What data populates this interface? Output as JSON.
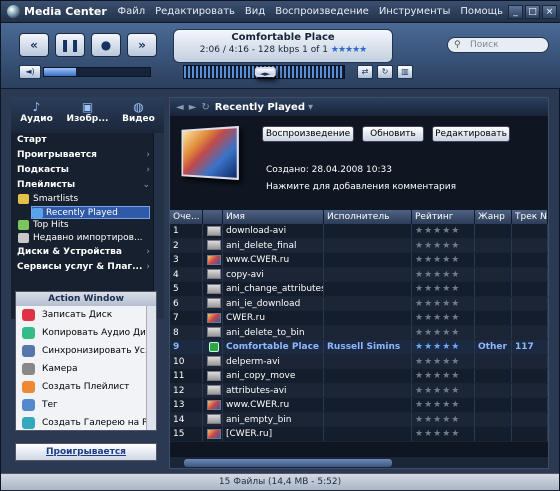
{
  "app": {
    "title": "Media Center"
  },
  "menu": [
    "Файл",
    "Редактировать",
    "Вид",
    "Воспроизведение",
    "Инструменты",
    "Помощь"
  ],
  "now_playing": {
    "title": "Comfortable Place",
    "info": "2:06 / 4:16 - 128 kbps  1 of 1",
    "rating_stars": "★★★★★"
  },
  "search": {
    "placeholder": "Поиск"
  },
  "sidebar": {
    "tabs": [
      {
        "label": "Аудио",
        "icon": "note-icon"
      },
      {
        "label": "Изобр...",
        "icon": "image-icon"
      },
      {
        "label": "Видео",
        "icon": "globe-icon"
      }
    ],
    "nav": [
      "Старт",
      "Проигрывается",
      "Подкасты",
      "Плейлисты"
    ],
    "playlists": [
      {
        "label": "Smartlists",
        "icon": "folder-icon",
        "color": "#e4c24a"
      },
      {
        "label": "Recently Played",
        "icon": "playlist-icon",
        "color": "#59a4e8"
      },
      {
        "label": "Top Hits",
        "icon": "playlist-icon",
        "color": "#7ac65a"
      },
      {
        "label": "Недавно импортиров...",
        "icon": "playlist-icon",
        "color": "#c8c8c8"
      }
    ],
    "nav2": [
      "Диски & Устройства",
      "Сервисы услуг & Плаг..."
    ],
    "action_window": {
      "title": "Action Window",
      "items": [
        {
          "label": "Записать Диск",
          "color": "#d34"
        },
        {
          "label": "Копировать Аудио Ди...",
          "color": "#3b8"
        },
        {
          "label": "Синхронизировать Ус...",
          "color": "#57a"
        },
        {
          "label": "Камера",
          "color": "#888"
        },
        {
          "label": "Создать Плейлист",
          "color": "#e83"
        },
        {
          "label": "Тег",
          "color": "#58c"
        },
        {
          "label": "Создать Галерею на Р...",
          "color": "#3ab"
        }
      ]
    },
    "now_playing_link": "Проигрывается"
  },
  "main": {
    "title": "Recently Played",
    "buttons": [
      "Воспроизведение",
      "Обновить",
      "Редактировать"
    ],
    "created": "Создано: 28.04.2008 10:33",
    "note": "Нажмите для добавления комментария",
    "columns": [
      "Оче...",
      "",
      "Имя",
      "Исполнитель",
      "Рейтинг",
      "Жанр",
      "Трек №"
    ],
    "rows": [
      {
        "n": "1",
        "icon": "file",
        "name": "download-avi",
        "artist": "",
        "genre": "",
        "track": ""
      },
      {
        "n": "2",
        "icon": "file",
        "name": "ani_delete_final",
        "artist": "",
        "genre": "",
        "track": ""
      },
      {
        "n": "3",
        "icon": "img",
        "name": "www.CWER.ru",
        "artist": "",
        "genre": "",
        "track": ""
      },
      {
        "n": "4",
        "icon": "file",
        "name": "copy-avi",
        "artist": "",
        "genre": "",
        "track": ""
      },
      {
        "n": "5",
        "icon": "file",
        "name": "ani_change_attributes",
        "artist": "",
        "genre": "",
        "track": ""
      },
      {
        "n": "6",
        "icon": "file",
        "name": "ani_ie_download",
        "artist": "",
        "genre": "",
        "track": ""
      },
      {
        "n": "7",
        "icon": "img",
        "name": "CWER.ru",
        "artist": "",
        "genre": "",
        "track": ""
      },
      {
        "n": "8",
        "icon": "file",
        "name": "ani_delete_to_bin",
        "artist": "",
        "genre": "",
        "track": ""
      },
      {
        "n": "9",
        "icon": "play",
        "name": "Comfortable Place",
        "artist": "Russell Simins",
        "genre": "Other",
        "track": "117",
        "playing": true
      },
      {
        "n": "10",
        "icon": "file",
        "name": "delperm-avi",
        "artist": "",
        "genre": "",
        "track": ""
      },
      {
        "n": "11",
        "icon": "file",
        "name": "ani_copy_move",
        "artist": "",
        "genre": "",
        "track": ""
      },
      {
        "n": "12",
        "icon": "file",
        "name": "attributes-avi",
        "artist": "",
        "genre": "",
        "track": ""
      },
      {
        "n": "13",
        "icon": "img",
        "name": "www.CWER.ru",
        "artist": "",
        "genre": "",
        "track": ""
      },
      {
        "n": "14",
        "icon": "file",
        "name": "ani_empty_bin",
        "artist": "",
        "genre": "",
        "track": ""
      },
      {
        "n": "15",
        "icon": "img",
        "name": "[CWER.ru]",
        "artist": "",
        "genre": "",
        "track": ""
      }
    ],
    "stars": "★★★★★"
  },
  "status": "15 Файлы (14,4 MB - 5:52)"
}
